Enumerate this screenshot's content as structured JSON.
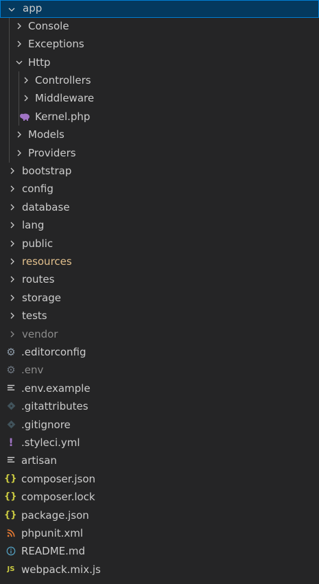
{
  "tree": {
    "app": "app",
    "console": "Console",
    "exceptions": "Exceptions",
    "http": "Http",
    "controllers": "Controllers",
    "middleware": "Middleware",
    "kernel": "Kernel.php",
    "models": "Models",
    "providers": "Providers",
    "bootstrap": "bootstrap",
    "config": "config",
    "database": "database",
    "lang": "lang",
    "public": "public",
    "resources": "resources",
    "routes": "routes",
    "storage": "storage",
    "tests": "tests",
    "vendor": "vendor",
    "editorconfig": ".editorconfig",
    "env": ".env",
    "env_example": ".env.example",
    "gitattributes": ".gitattributes",
    "gitignore": ".gitignore",
    "styleci": ".styleci.yml",
    "artisan": "artisan",
    "composer_json": "composer.json",
    "composer_lock": "composer.lock",
    "package_json": "package.json",
    "phpunit": "phpunit.xml",
    "readme": "README.md",
    "webpack": "webpack.mix.js"
  },
  "colors": {
    "background": "#252526",
    "selected_bg": "#04395e",
    "selected_border": "#007fd4",
    "text": "#cccccc",
    "ignored_text": "#8c8c8c",
    "modified_text": "#e2c08d",
    "json_icon": "#cbcb41",
    "xml_icon": "#e37933",
    "php_icon": "#a074c4",
    "info_icon": "#519aba"
  },
  "icons": {
    "folder_open": "chevron-down-icon",
    "folder_closed": "chevron-right-icon",
    "php": "php-elephant-icon",
    "gear": "gear-icon",
    "lines": "text-file-icon",
    "git": "git-icon",
    "yml": "exclamation-icon",
    "json": "braces-icon",
    "xml": "rss-icon",
    "info": "info-icon",
    "js": "js-icon"
  }
}
